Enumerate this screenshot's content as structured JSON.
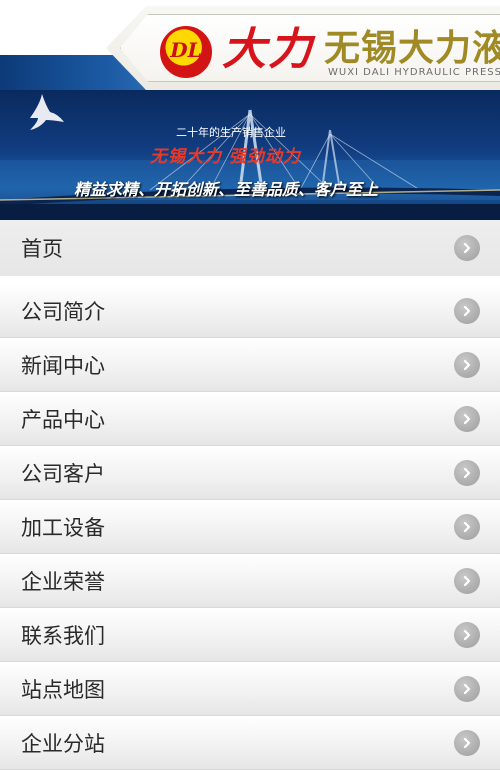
{
  "header": {
    "logo_mark": "DL",
    "brand_name": "大力",
    "brand_full": "无锡大力液",
    "brand_en": "WUXI DALI HYDRAULIC PRESS"
  },
  "banner": {
    "subtitle": "二十年的生产销售企业",
    "slogan": "无锡大力 强劲动力",
    "motto": "精益求精、开拓创新、至善品质、客户至上"
  },
  "nav": {
    "items": [
      {
        "label": "首页"
      },
      {
        "label": "公司简介"
      },
      {
        "label": "新闻中心"
      },
      {
        "label": "产品中心"
      },
      {
        "label": "公司客户"
      },
      {
        "label": "加工设备"
      },
      {
        "label": "企业荣誉"
      },
      {
        "label": "联系我们"
      },
      {
        "label": "站点地图"
      },
      {
        "label": "企业分站"
      }
    ],
    "arrow_icon": "chevron-right-icon"
  },
  "colors": {
    "brand_red": "#d7141c",
    "banner_blue": "#113c80",
    "arrow_gray": "#a8a8a8"
  }
}
